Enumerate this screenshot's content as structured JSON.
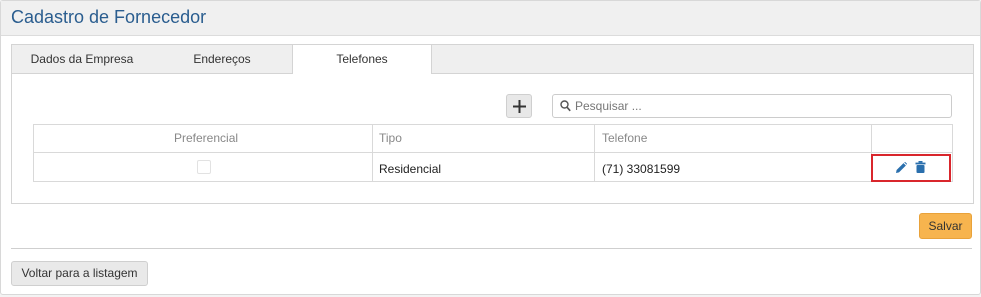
{
  "page": {
    "title": "Cadastro de Fornecedor"
  },
  "tabs": [
    {
      "label": "Dados da Empresa"
    },
    {
      "label": "Endereços"
    },
    {
      "label": "Telefones",
      "active": true
    }
  ],
  "toolbar": {
    "add_icon": "plus-icon",
    "search_placeholder": "Pesquisar ...",
    "search_value": ""
  },
  "table": {
    "columns": [
      "Preferencial",
      "Tipo",
      "Telefone",
      ""
    ],
    "rows": [
      {
        "preferencial": false,
        "tipo": "Residencial",
        "telefone": "(71) 33081599"
      }
    ],
    "row_actions": [
      "pencil-icon",
      "trash-icon"
    ]
  },
  "buttons": {
    "save": "Salvar",
    "back": "Voltar para a listagem"
  },
  "colors": {
    "title": "#2a5d8f",
    "action_icons": "#2a6fad",
    "save_button": "#f7b44e",
    "highlight_border": "#d9262c"
  }
}
